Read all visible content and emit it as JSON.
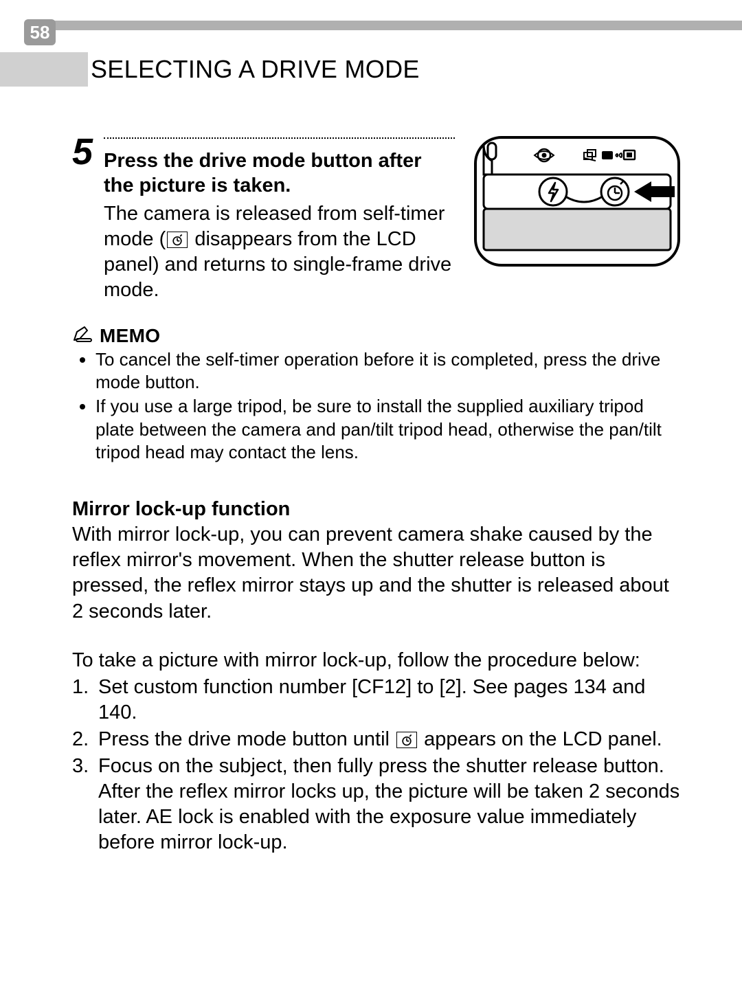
{
  "page_number": "58",
  "section_title": "SELECTING A DRIVE MODE",
  "step": {
    "number": "5",
    "title": "Press the drive mode button after the picture is taken.",
    "body_pre": "The camera is released from self-timer mode (",
    "body_post": " disappears from the LCD panel) and returns to single-frame drive mode."
  },
  "memo": {
    "label": "MEMO",
    "icon_name": "pencil-memo-icon",
    "items": [
      "To cancel the self-timer operation before it is completed, press the drive mode button.",
      "If you use a large tripod, be sure to install the supplied auxiliary tripod plate between the camera and pan/tilt tripod head, otherwise the pan/tilt tripod head may contact the lens."
    ]
  },
  "mirror": {
    "heading": "Mirror lock-up function",
    "intro": "With mirror lock-up, you can prevent camera shake caused by the reflex mirror's movement. When the shutter release button is pressed, the reflex mirror stays up and the shutter is released about 2 seconds later.",
    "lead": "To take a picture with mirror lock-up, follow the procedure below:",
    "step1": "Set custom function number [CF12] to [2]. See pages 134 and 140.",
    "step2_pre": "Press the drive mode button until ",
    "step2_post": " appears on the LCD panel.",
    "step3_line1": "Focus on the subject, then fully press the shutter release button.",
    "step3_line2": "After the reflex mirror locks up, the picture will be taken 2 seconds later. AE lock is enabled with the exposure value immediately before mirror lock-up."
  },
  "diagram": {
    "icons": {
      "redeye": "redeye-icon",
      "drive_bracket": "drive-mode-icons",
      "flash": "flash-icon",
      "timer": "self-timer-icon",
      "arrow": "right-arrow-icon"
    }
  }
}
